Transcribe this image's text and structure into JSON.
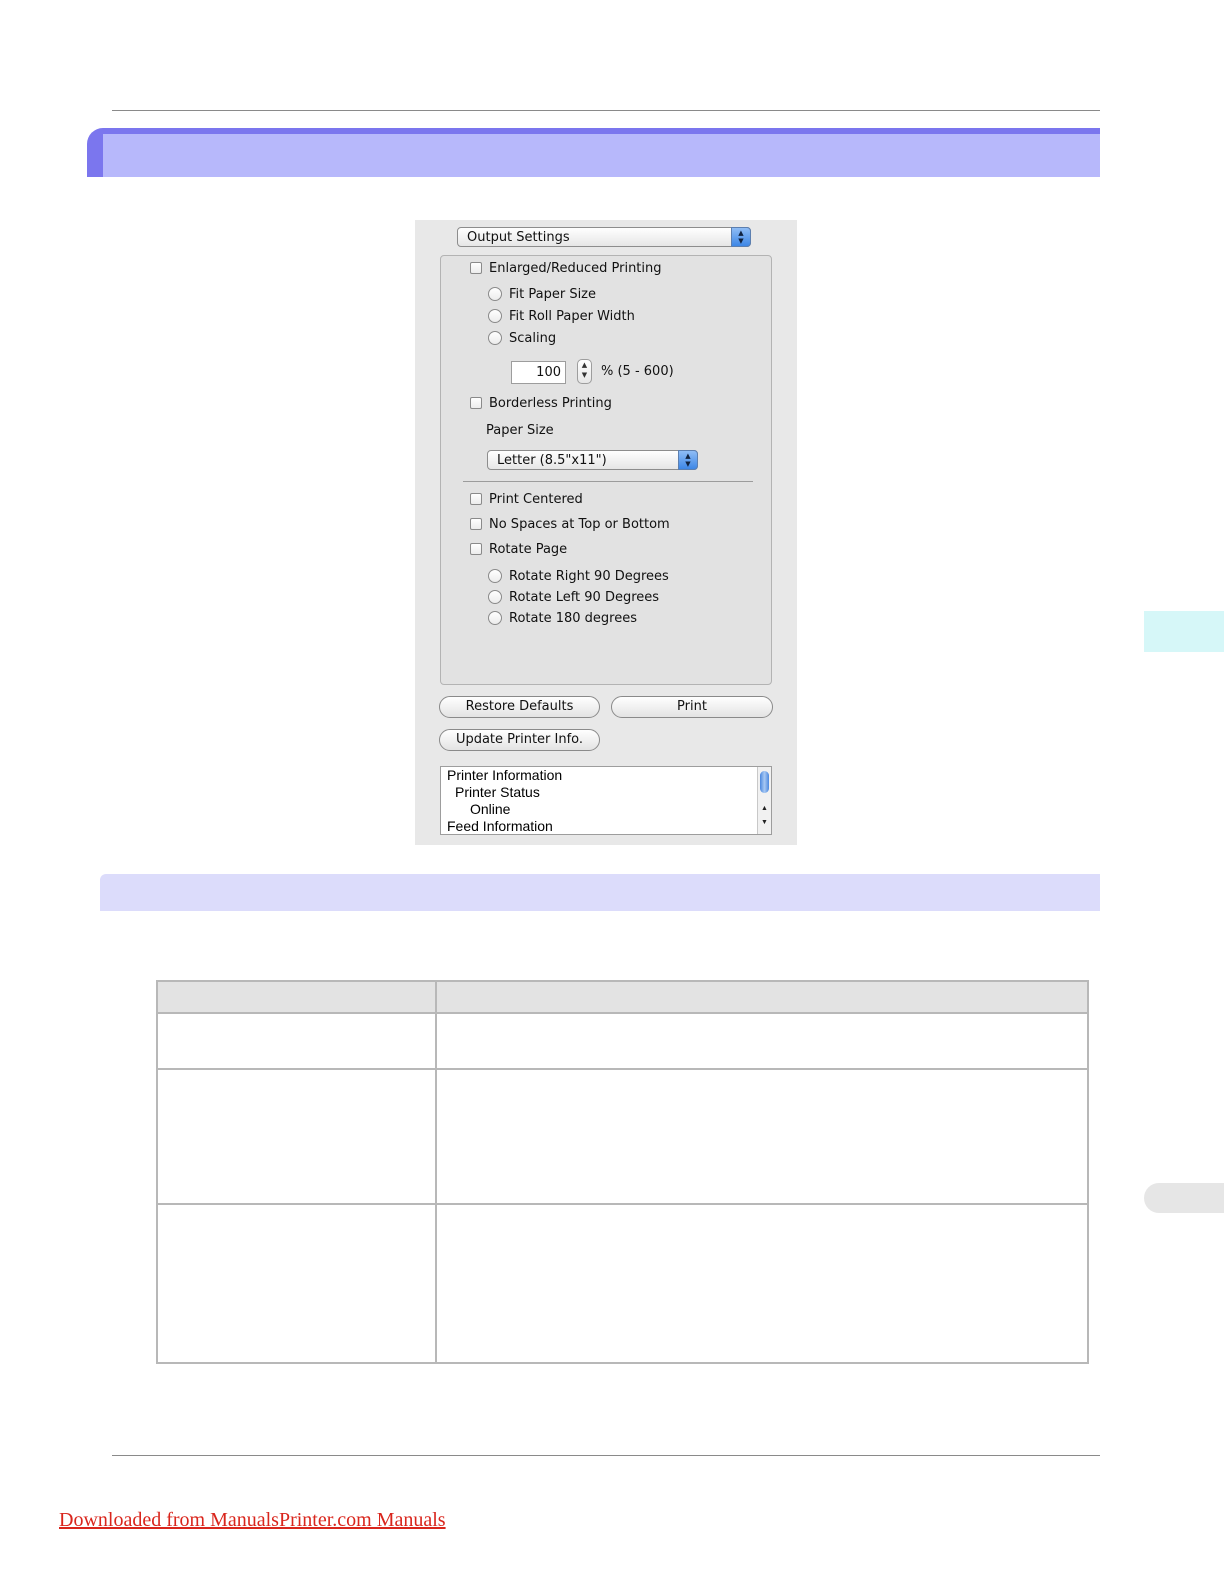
{
  "dialog": {
    "panel_select": "Output Settings",
    "enlarged_reduced": "Enlarged/Reduced Printing",
    "fit_paper_size": "Fit Paper Size",
    "fit_roll_paper_width": "Fit Roll Paper Width",
    "scaling": "Scaling",
    "scaling_value": "100",
    "scaling_range": "% (5 - 600)",
    "borderless": "Borderless Printing",
    "paper_size_label": "Paper Size",
    "paper_size_value": "Letter (8.5\"x11\")",
    "print_centered": "Print Centered",
    "no_spaces": "No Spaces at Top or Bottom",
    "rotate_page": "Rotate Page",
    "rotate_right": "Rotate Right 90 Degrees",
    "rotate_left": "Rotate Left 90 Degrees",
    "rotate_180": "Rotate 180 degrees",
    "restore_defaults": "Restore Defaults",
    "print": "Print",
    "update_printer_info": "Update Printer Info.",
    "info_lines": [
      "Printer Information",
      "Printer Status",
      "Online",
      "Feed Information"
    ]
  },
  "footer": {
    "link_text": "Downloaded from ManualsPrinter.com Manuals"
  }
}
